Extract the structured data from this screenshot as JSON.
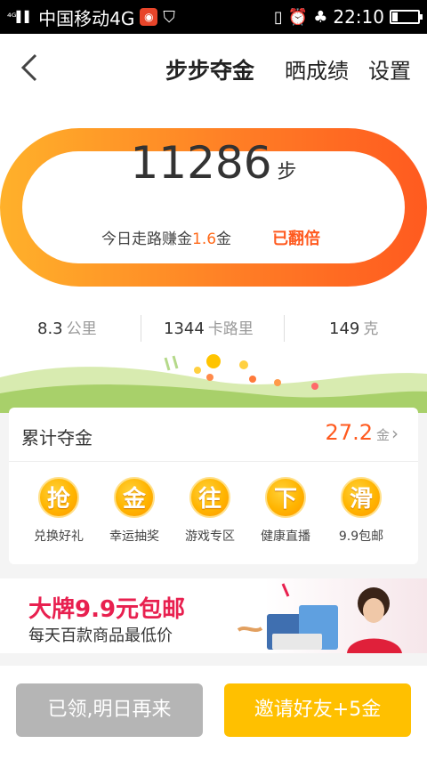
{
  "status_bar": {
    "carrier": "中国移动4G",
    "time": "22:10",
    "battery_percent": 20,
    "icons": [
      "signal-icon",
      "app-icon",
      "shield-icon",
      "vibrate-icon",
      "alarm-icon",
      "tree-icon"
    ]
  },
  "nav": {
    "back_icon": "chevron-left-icon",
    "title": "步步夺金",
    "share": "晒成绩",
    "settings": "设置"
  },
  "hero": {
    "steps": "11286",
    "steps_unit": "步",
    "earn_prefix": "今日走路赚金",
    "earn_amount": "1.6",
    "earn_suffix": "金",
    "doubled": "已翻倍"
  },
  "stats": [
    {
      "value": "8.3",
      "unit": "公里"
    },
    {
      "value": "1344",
      "unit": "卡路里"
    },
    {
      "value": "149",
      "unit": "克"
    }
  ],
  "card": {
    "title": "累计夺金",
    "amount": "27.2",
    "amount_unit": "金",
    "features": [
      {
        "icon": "抢",
        "label": "兑换好礼"
      },
      {
        "icon": "金",
        "label": "幸运抽奖"
      },
      {
        "icon": "往",
        "label": "游戏专区"
      },
      {
        "icon": "下",
        "label": "健康直播"
      },
      {
        "icon": "滑",
        "label": "9.9包邮"
      }
    ]
  },
  "banner": {
    "title": "大牌9.9元包邮",
    "subtitle": "每天百款商品最低价"
  },
  "buttons": {
    "claimed": "已领,明日再来",
    "invite": "邀请好友+5金"
  },
  "colors": {
    "accent_orange": "#ff5a1f",
    "gold": "#ffc000",
    "banner_pink": "#e8204f"
  }
}
